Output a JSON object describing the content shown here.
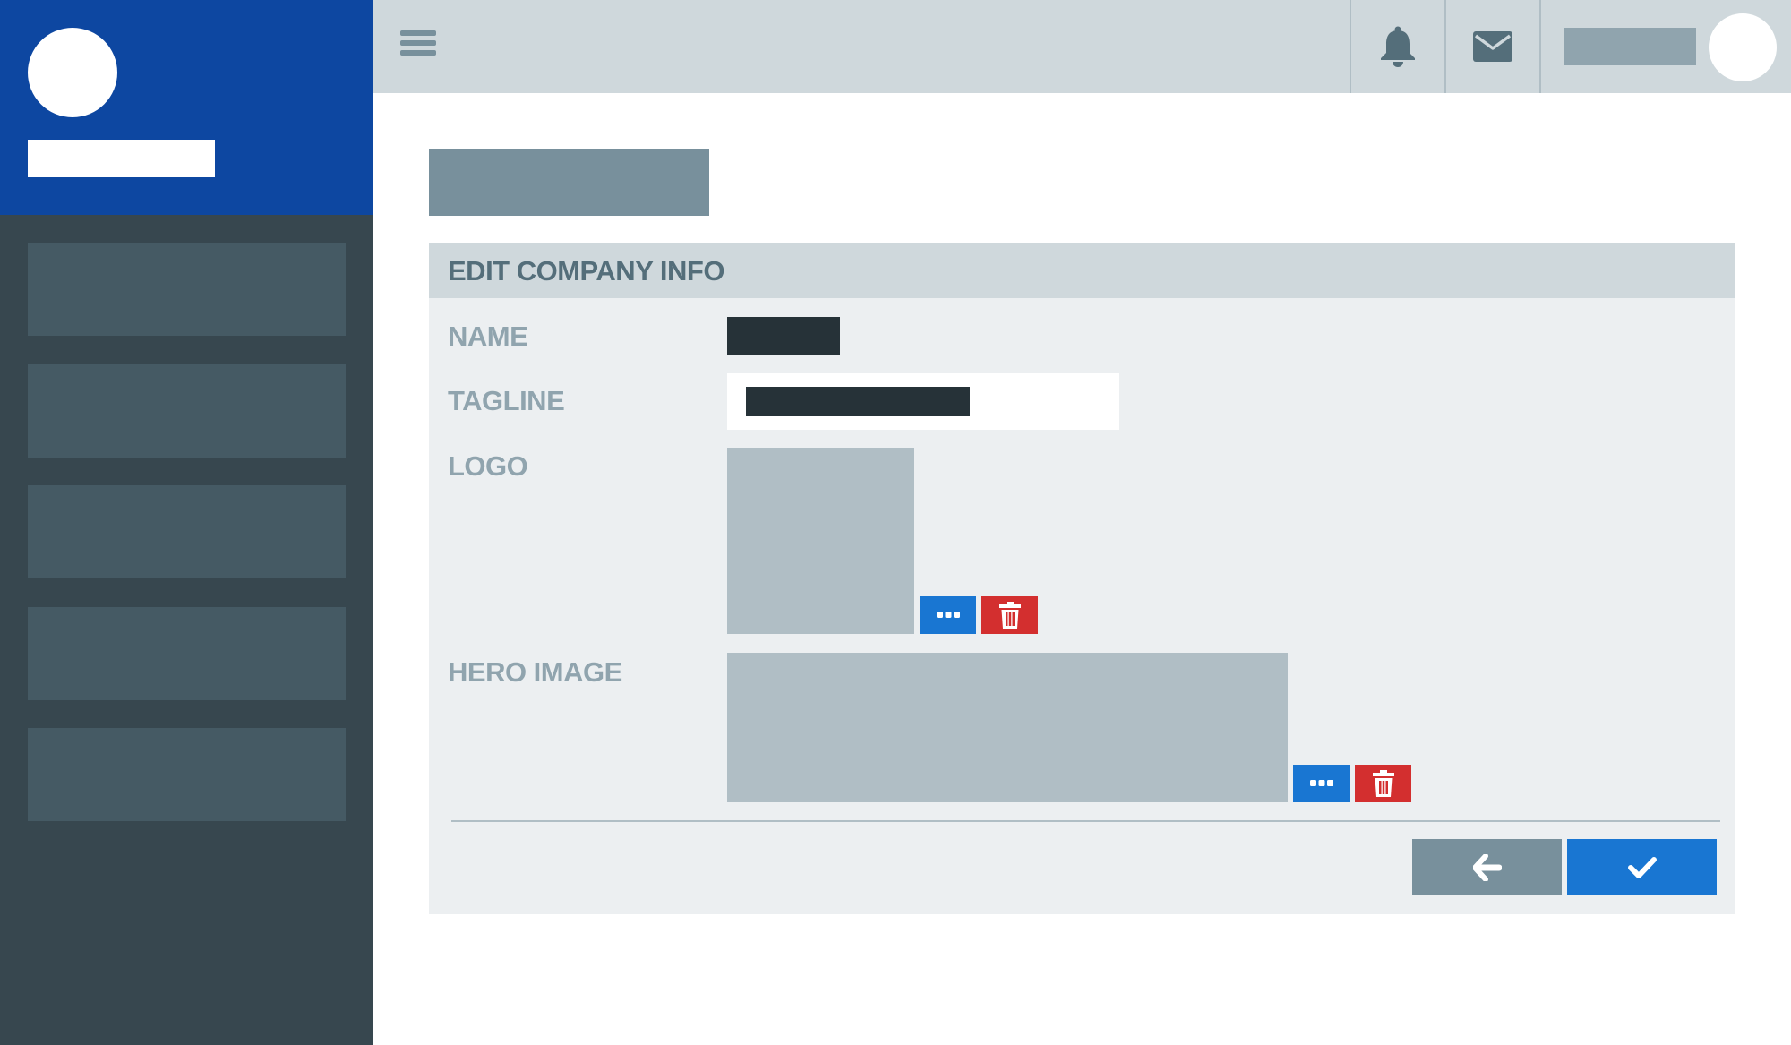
{
  "colors": {
    "brand": "#0d47a1",
    "sidebar": "#37474f",
    "sidebar_item": "#455a64",
    "topbar": "#cfd8dc",
    "card": "#eceff1",
    "primary": "#1976d2",
    "danger": "#d32f2f",
    "secondary": "#78909c"
  },
  "sidebar": {
    "items": [
      {
        "id": "nav-1"
      },
      {
        "id": "nav-2"
      },
      {
        "id": "nav-3"
      },
      {
        "id": "nav-4"
      },
      {
        "id": "nav-5"
      }
    ]
  },
  "topbar": {
    "icons": [
      "menu-icon",
      "bell-icon",
      "mail-icon"
    ]
  },
  "form": {
    "title": "EDIT COMPANY INFO",
    "fields": {
      "name_label": "NAME",
      "tagline_label": "TAGLINE",
      "logo_label": "LOGO",
      "hero_label": "HERO IMAGE"
    },
    "image_actions": [
      "more-icon",
      "trash-icon"
    ],
    "footer_actions": [
      "arrow-left-icon",
      "check-icon"
    ]
  }
}
